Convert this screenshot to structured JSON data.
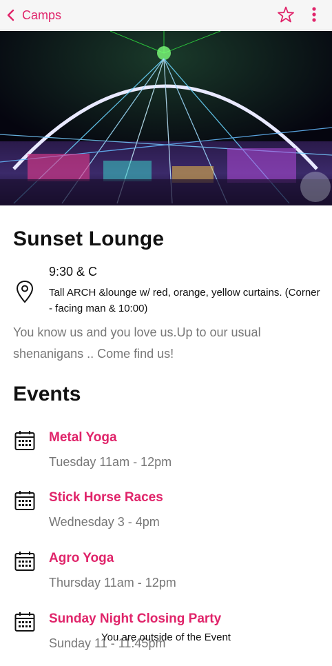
{
  "topbar": {
    "back_label": "Camps"
  },
  "camp": {
    "name": "Sunset Lounge",
    "address": "9:30 & C",
    "location_detail": "Tall ARCH &lounge w/ red, orange, yellow curtains. (Corner - facing man & 10:00)",
    "description": "You know us and you love us.Up to our usual shenanigans .. Come find us!"
  },
  "events_heading": "Events",
  "events": [
    {
      "name": "Metal Yoga",
      "time": "Tuesday 11am - 12pm"
    },
    {
      "name": "Stick Horse Races",
      "time": "Wednesday 3 - 4pm"
    },
    {
      "name": "Agro Yoga",
      "time": "Thursday 11am - 12pm"
    },
    {
      "name": "Sunday Night Closing Party",
      "time": "Sunday 11 - 11:45pm"
    }
  ],
  "toast": "You are outside of the Event",
  "colors": {
    "accent": "#e0246a",
    "muted_text": "#777777",
    "topbar_bg": "#f6f6f6"
  },
  "icons": [
    "chevron-left-icon",
    "star-outline-icon",
    "more-vert-icon",
    "map-pin-icon",
    "calendar-icon"
  ]
}
